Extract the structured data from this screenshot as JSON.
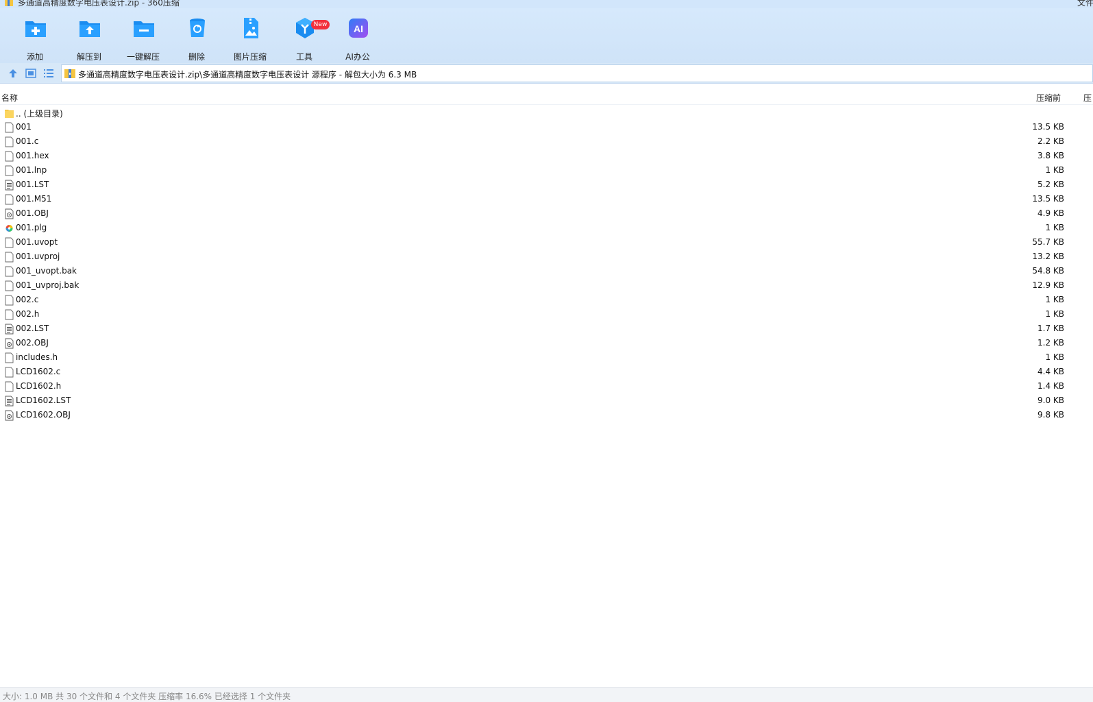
{
  "window": {
    "title": "多通道高精度数字电压表设计.zip - 360压缩",
    "title_right": "文件"
  },
  "toolbar": {
    "items": [
      {
        "label": "添加",
        "icon": "add-folder-icon"
      },
      {
        "label": "解压到",
        "icon": "extract-to-icon"
      },
      {
        "label": "一键解压",
        "icon": "one-click-extract-icon"
      },
      {
        "label": "删除",
        "icon": "delete-bin-icon"
      },
      {
        "label": "图片压缩",
        "icon": "image-compress-icon"
      },
      {
        "label": "工具",
        "icon": "tools-cube-icon"
      },
      {
        "label": "AI办公",
        "icon": "ai-office-icon"
      }
    ],
    "badge": "New"
  },
  "addressbar": {
    "path": "多通道高精度数字电压表设计.zip\\多通道高精度数字电压表设计 源程序 - 解包大小为 6.3 MB"
  },
  "columns": {
    "name": "名称",
    "size_before": "压缩前",
    "size_after": "压"
  },
  "files": [
    {
      "name": ".. (上级目录)",
      "size": "",
      "type": "folder"
    },
    {
      "name": "001",
      "size": "13.5 KB",
      "type": "blank"
    },
    {
      "name": "001.c",
      "size": "2.2 KB",
      "type": "blank"
    },
    {
      "name": "001.hex",
      "size": "3.8 KB",
      "type": "blank"
    },
    {
      "name": "001.lnp",
      "size": "1 KB",
      "type": "blank"
    },
    {
      "name": "001.LST",
      "size": "5.2 KB",
      "type": "text"
    },
    {
      "name": "001.M51",
      "size": "13.5 KB",
      "type": "blank"
    },
    {
      "name": "001.OBJ",
      "size": "4.9 KB",
      "type": "obj"
    },
    {
      "name": "001.plg",
      "size": "1 KB",
      "type": "color"
    },
    {
      "name": "001.uvopt",
      "size": "55.7 KB",
      "type": "blank"
    },
    {
      "name": "001.uvproj",
      "size": "13.2 KB",
      "type": "blank"
    },
    {
      "name": "001_uvopt.bak",
      "size": "54.8 KB",
      "type": "blank"
    },
    {
      "name": "001_uvproj.bak",
      "size": "12.9 KB",
      "type": "blank"
    },
    {
      "name": "002.c",
      "size": "1 KB",
      "type": "blank"
    },
    {
      "name": "002.h",
      "size": "1 KB",
      "type": "blank"
    },
    {
      "name": "002.LST",
      "size": "1.7 KB",
      "type": "text"
    },
    {
      "name": "002.OBJ",
      "size": "1.2 KB",
      "type": "obj"
    },
    {
      "name": "includes.h",
      "size": "1 KB",
      "type": "blank"
    },
    {
      "name": "LCD1602.c",
      "size": "4.4 KB",
      "type": "blank"
    },
    {
      "name": "LCD1602.h",
      "size": "1.4 KB",
      "type": "blank"
    },
    {
      "name": "LCD1602.LST",
      "size": "9.0 KB",
      "type": "text"
    },
    {
      "name": "LCD1602.OBJ",
      "size": "9.8 KB",
      "type": "obj"
    }
  ],
  "statusbar": {
    "text": "大小: 1.0 MB 共 30 个文件和 4 个文件夹 压缩率 16.6% 已经选择 1 个文件夹"
  },
  "colors": {
    "toolbar_bg": "#d6e9fc",
    "accent_blue": "#1a8cf0",
    "badge_red": "#f2303c",
    "ai_gradient_start": "#2f7cf6",
    "ai_gradient_end": "#a34df0"
  }
}
